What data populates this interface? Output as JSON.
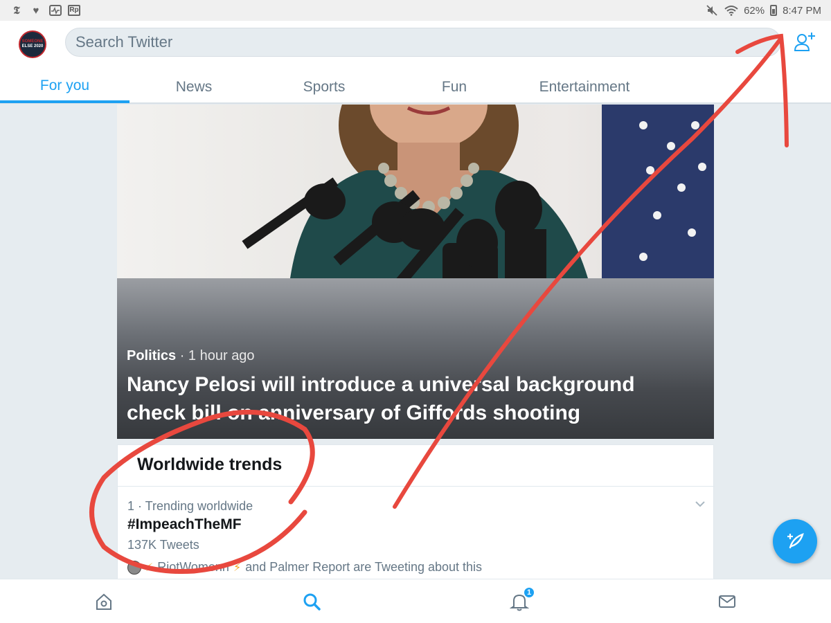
{
  "status_bar": {
    "left_icons": [
      "nyt-icon",
      "heart-icon",
      "pulse-icon",
      "rp-icon"
    ],
    "rp_label": "Rp",
    "battery": "62%",
    "time": "8:47 PM"
  },
  "header": {
    "avatar_line1": "SOMEONE",
    "avatar_line2": "ELSE 2020",
    "search_placeholder": "Search Twitter",
    "tabs": [
      {
        "label": "For you",
        "active": true
      },
      {
        "label": "News",
        "active": false
      },
      {
        "label": "Sports",
        "active": false
      },
      {
        "label": "Fun",
        "active": false
      },
      {
        "label": "Entertainment",
        "active": false
      }
    ]
  },
  "hero": {
    "category": "Politics",
    "separator": " · ",
    "time_ago": "1 hour ago",
    "headline": "Nancy Pelosi will introduce a universal background check bill on anniversary of Giffords shooting"
  },
  "trends": {
    "title": "Worldwide trends",
    "items": [
      {
        "rank_label": "1 · Trending worldwide",
        "name": "#ImpeachTheMF",
        "count": "137K Tweets",
        "tweeter_1": "RiotWomenn",
        "tweeting_about": "and Palmer Report are Tweeting about this"
      }
    ]
  },
  "bottom_nav": {
    "items": [
      "home-icon",
      "search-icon",
      "notifications-icon",
      "messages-icon"
    ],
    "notification_badge": "1"
  },
  "colors": {
    "accent": "#1da1f2",
    "annotation": "#e8483e"
  }
}
